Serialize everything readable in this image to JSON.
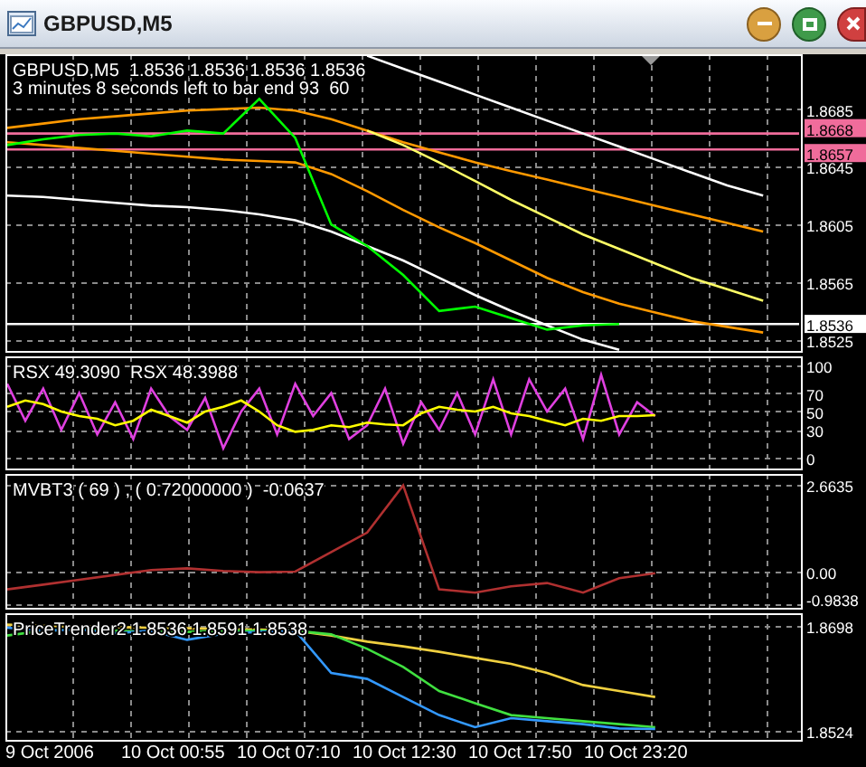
{
  "window": {
    "title": "GBPUSD,M5"
  },
  "shift_marker": true,
  "panels": [
    {
      "legend": [
        "GBPUSD,M5  1.8536 1.8536 1.8536 1.8536",
        "3 minutes 8 seconds left to bar end 93  60"
      ],
      "chart_data": {
        "type": "line",
        "categories": [
          null,
          null,
          null,
          null,
          null,
          null,
          null,
          null,
          null,
          null,
          null,
          null,
          null,
          null,
          null,
          null,
          null,
          null,
          null,
          null,
          null,
          null,
          null
        ],
        "ylim": [
          1.8516,
          1.8723
        ],
        "yticks": [
          {
            "value": 1.8685,
            "label": "1.8685"
          },
          {
            "value": 1.8645,
            "label": "1.8645"
          },
          {
            "value": 1.8605,
            "label": "1.8605"
          },
          {
            "value": 1.8565,
            "label": "1.8565"
          },
          {
            "value": 1.8525,
            "label": "1.8525"
          }
        ],
        "grid": true,
        "series": [
          {
            "name": "1.8668",
            "color": "#f06c9b",
            "values": [
              1.8668,
              1.8668,
              1.8668,
              1.8668,
              1.8668,
              1.8668,
              1.8668,
              1.8668,
              1.8668,
              1.8668,
              1.8668,
              1.8668,
              1.8668,
              1.8668,
              1.8668,
              1.8668,
              1.8668,
              1.8668,
              1.8668,
              1.8668,
              1.8668,
              1.8668,
              1.8668
            ]
          },
          {
            "name": "1.8657",
            "color": "#f06c9b",
            "values": [
              1.8657,
              1.8657,
              1.8657,
              1.8657,
              1.8657,
              1.8657,
              1.8657,
              1.8657,
              1.8657,
              1.8657,
              1.8657,
              1.8657,
              1.8657,
              1.8657,
              1.8657,
              1.8657,
              1.8657,
              1.8657,
              1.8657,
              1.8657,
              1.8657,
              1.8657,
              1.8657
            ]
          },
          {
            "name": "1.8536",
            "color": "#ffffff",
            "values": [
              1.8536,
              1.8536,
              1.8536,
              1.8536,
              1.8536,
              1.8536,
              1.8536,
              1.8536,
              1.8536,
              1.8536,
              1.8536,
              1.8536,
              1.8536,
              1.8536,
              1.8536,
              1.8536,
              1.8536,
              1.8536,
              1.8536,
              1.8536,
              1.8536,
              1.8536,
              1.8536
            ]
          },
          {
            "color": "#ff9900",
            "values": [
              1.8672,
              1.8675,
              1.8678,
              1.868,
              1.8682,
              1.8684,
              1.8685,
              1.8686,
              1.8684,
              1.8678,
              1.867,
              1.8662,
              1.8655,
              1.8648,
              1.8642,
              1.8636,
              1.863,
              1.8624,
              1.8618,
              1.8612,
              1.8606,
              1.86,
              null
            ]
          },
          {
            "color": "#ff9900",
            "values": [
              1.8662,
              1.866,
              1.8658,
              1.8656,
              1.8654,
              1.8652,
              1.865,
              1.8649,
              1.8648,
              1.864,
              1.8628,
              1.8615,
              1.8603,
              1.8592,
              1.858,
              1.8568,
              1.8558,
              1.855,
              1.8544,
              1.8538,
              1.8534,
              1.853,
              null
            ]
          },
          {
            "color": "#ffffff",
            "values": [
              null,
              null,
              null,
              null,
              null,
              null,
              null,
              null,
              null,
              null,
              1.8722,
              1.8713,
              1.8704,
              1.8695,
              1.8686,
              1.8677,
              1.8668,
              1.8659,
              1.865,
              1.8641,
              1.8632,
              1.8625,
              null
            ]
          },
          {
            "color": "#ffffff",
            "values": [
              1.8625,
              1.8624,
              1.8622,
              1.862,
              1.8618,
              1.8617,
              1.8615,
              1.8612,
              1.8608,
              1.86,
              1.859,
              1.858,
              1.8568,
              1.8556,
              1.8545,
              1.8535,
              1.8525,
              1.8518,
              null,
              null,
              null,
              null,
              null
            ]
          },
          {
            "color": "#ffff66",
            "values": [
              null,
              null,
              null,
              null,
              null,
              null,
              null,
              null,
              null,
              null,
              1.867,
              1.866,
              1.8648,
              1.8635,
              1.8622,
              1.861,
              1.8598,
              1.8588,
              1.8578,
              1.8568,
              1.856,
              1.8552,
              null
            ]
          },
          {
            "color": "#00ff00",
            "values": [
              1.866,
              1.8664,
              1.8667,
              1.8668,
              1.8666,
              1.867,
              1.8668,
              1.8692,
              1.8665,
              1.8605,
              1.859,
              1.857,
              1.8545,
              1.8548,
              1.854,
              1.8532,
              1.8535,
              1.8536,
              null,
              null,
              null,
              null,
              null
            ]
          }
        ]
      }
    },
    {
      "legend": [
        "RSX 49.3090  RSX 48.3988"
      ],
      "chart_data": {
        "type": "line",
        "categories": [
          null,
          null,
          null,
          null,
          null,
          null,
          null,
          null,
          null,
          null,
          null,
          null,
          null,
          null,
          null,
          null,
          null,
          null,
          null,
          null,
          null,
          null,
          null,
          null,
          null,
          null,
          null,
          null,
          null,
          null,
          null,
          null,
          null,
          null,
          null,
          null,
          null,
          null,
          null,
          null,
          null,
          null,
          null,
          null,
          null
        ],
        "ylim": [
          -14,
          110
        ],
        "grid": true,
        "yticks": [
          {
            "value": 100,
            "label": "100"
          },
          {
            "value": 70,
            "label": "70"
          },
          {
            "value": 50,
            "label": "50"
          },
          {
            "value": 30,
            "label": "30"
          },
          {
            "value": 0,
            "label": "0"
          }
        ],
        "series": [
          {
            "color": "#e040e0",
            "values": [
              80,
              40,
              75,
              30,
              70,
              25,
              60,
              20,
              75,
              45,
              30,
              65,
              10,
              50,
              75,
              25,
              80,
              45,
              70,
              20,
              35,
              75,
              15,
              60,
              30,
              70,
              25,
              85,
              25,
              85,
              50,
              75,
              20,
              90,
              25,
              60,
              45,
              null,
              null,
              null,
              null,
              null,
              null,
              null,
              null
            ]
          },
          {
            "color": "#ffff00",
            "values": [
              55,
              62,
              58,
              50,
              45,
              42,
              35,
              40,
              52,
              45,
              38,
              50,
              55,
              62,
              50,
              35,
              28,
              30,
              35,
              33,
              38,
              36,
              35,
              48,
              55,
              52,
              50,
              55,
              48,
              45,
              40,
              35,
              42,
              40,
              45,
              45,
              46,
              null,
              null,
              null,
              null,
              null,
              null,
              null,
              null
            ]
          }
        ]
      }
    },
    {
      "legend": [
        "MVBT3 ( 69 ) , ( 0.72000000 )  -0.0637"
      ],
      "chart_data": {
        "type": "line",
        "categories": [
          null,
          null,
          null,
          null,
          null,
          null,
          null,
          null,
          null,
          null,
          null,
          null,
          null,
          null,
          null,
          null,
          null,
          null,
          null,
          null,
          null,
          null,
          null
        ],
        "ylim": [
          -1.17,
          3.0
        ],
        "grid": true,
        "yticks": [
          {
            "value": 2.6635,
            "label": "2.6635"
          },
          {
            "value": 0,
            "label": "0.00"
          },
          {
            "value": -0.9838,
            "label": "-0.9838"
          }
        ],
        "series": [
          {
            "color": "#b03030",
            "values": [
              -0.55,
              -0.4,
              -0.25,
              -0.1,
              0.05,
              0.1,
              0.02,
              -0.02,
              0.0,
              0.6,
              1.2,
              2.65,
              -0.55,
              -0.65,
              -0.45,
              -0.35,
              -0.65,
              -0.2,
              -0.05,
              null,
              null,
              null,
              null
            ]
          }
        ]
      }
    },
    {
      "legend": [
        "PriceTrender2 1.8536 1.8591 1.8538"
      ],
      "chart_data": {
        "type": "line",
        "categories": [
          null,
          null,
          null,
          null,
          null,
          null,
          null,
          null,
          null,
          null,
          null,
          null,
          null,
          null,
          null,
          null,
          null,
          null,
          null,
          null,
          null,
          null,
          null
        ],
        "ylim": [
          1.8506,
          1.8719
        ],
        "grid": true,
        "yticks": [
          {
            "value": 1.8698,
            "label": "1.8698"
          },
          {
            "value": 1.8524,
            "label": "1.8524"
          }
        ],
        "series": [
          {
            "color": "#f0d040",
            "values": [
              1.87,
              1.8698,
              1.8697,
              1.8696,
              1.8695,
              1.8694,
              1.8693,
              1.8692,
              1.869,
              1.8682,
              1.8672,
              1.8664,
              1.8655,
              1.8645,
              1.8635,
              1.862,
              1.86,
              1.859,
              1.858,
              null,
              null,
              null,
              null
            ]
          },
          {
            "color": "#40e040",
            "values": [
              1.8682,
              1.869,
              1.8692,
              1.869,
              1.8688,
              1.8688,
              1.869,
              1.869,
              1.869,
              1.8684,
              1.866,
              1.863,
              1.859,
              1.857,
              1.855,
              1.8545,
              1.854,
              1.8535,
              1.853,
              null,
              null,
              null,
              null
            ]
          },
          {
            "color": "#3399ff",
            "values": [
              1.8695,
              1.869,
              1.8692,
              1.8686,
              1.869,
              1.8675,
              1.8685,
              1.8688,
              1.869,
              1.862,
              1.861,
              1.858,
              1.855,
              1.853,
              1.8545,
              1.854,
              1.8535,
              1.8528,
              1.8527,
              null,
              null,
              null,
              null
            ]
          }
        ]
      }
    }
  ],
  "time_axis": [
    "9 Oct 2006",
    "10 Oct 00:55",
    "10 Oct 07:10",
    "10 Oct 12:30",
    "10 Oct 17:50",
    "10 Oct 23:20"
  ]
}
